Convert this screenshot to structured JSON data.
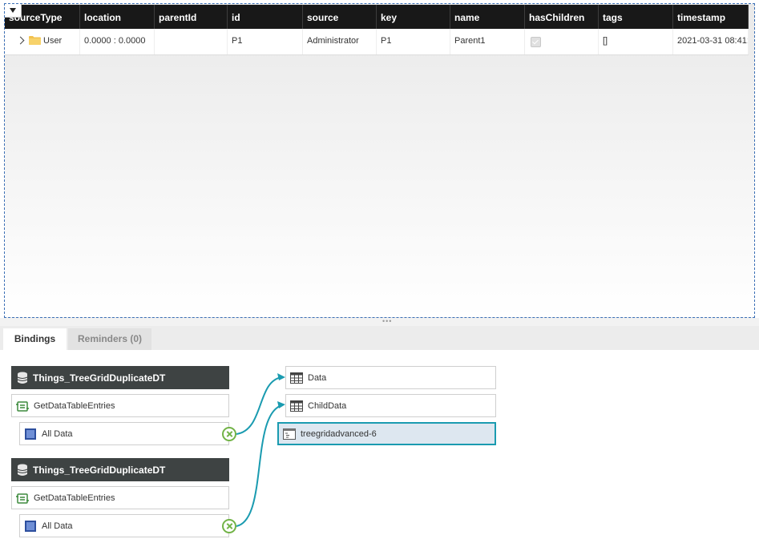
{
  "grid": {
    "columns": [
      "sourceType",
      "location",
      "parentId",
      "id",
      "source",
      "key",
      "name",
      "hasChildren",
      "tags",
      "timestamp"
    ],
    "rows": [
      {
        "sourceType": "User",
        "location": "0.0000 : 0.0000",
        "parentId": "",
        "id": "P1",
        "source": "Administrator",
        "key": "P1",
        "name": "Parent1",
        "hasChildren": "true",
        "tags": "[]",
        "timestamp": "2021-03-31 08:41:"
      }
    ]
  },
  "tabs": {
    "bindings": "Bindings",
    "reminders": "Reminders (0)"
  },
  "bindings": {
    "sources": [
      {
        "thing": "Things_TreeGridDuplicateDT",
        "service": "GetDataTableEntries",
        "output": "All Data"
      },
      {
        "thing": "Things_TreeGridDuplicateDT",
        "service": "GetDataTableEntries",
        "output": "All Data"
      }
    ],
    "targets": [
      "Data",
      "ChildData"
    ],
    "widget": "treegridadvanced-6"
  },
  "colors": {
    "header": "#181818",
    "source_header": "#3e4343",
    "wire": "#1a9bb0",
    "remove": "#72b347"
  }
}
